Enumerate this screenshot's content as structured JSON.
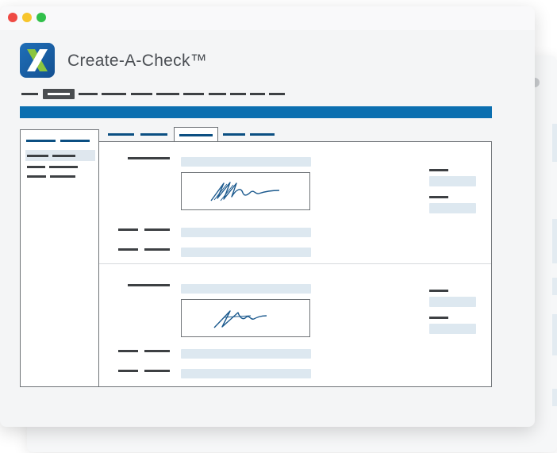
{
  "app": {
    "title": "Create-A-Check™",
    "logo_glyph": "X",
    "brand_color": "#0b6fb0",
    "logo_colors": [
      "#1f6fb8",
      "#8bc53f"
    ]
  },
  "window_controls": [
    "close",
    "minimize",
    "maximize"
  ],
  "checks": [
    {
      "signature": "signature-1"
    },
    {
      "signature": "signature-2"
    }
  ]
}
